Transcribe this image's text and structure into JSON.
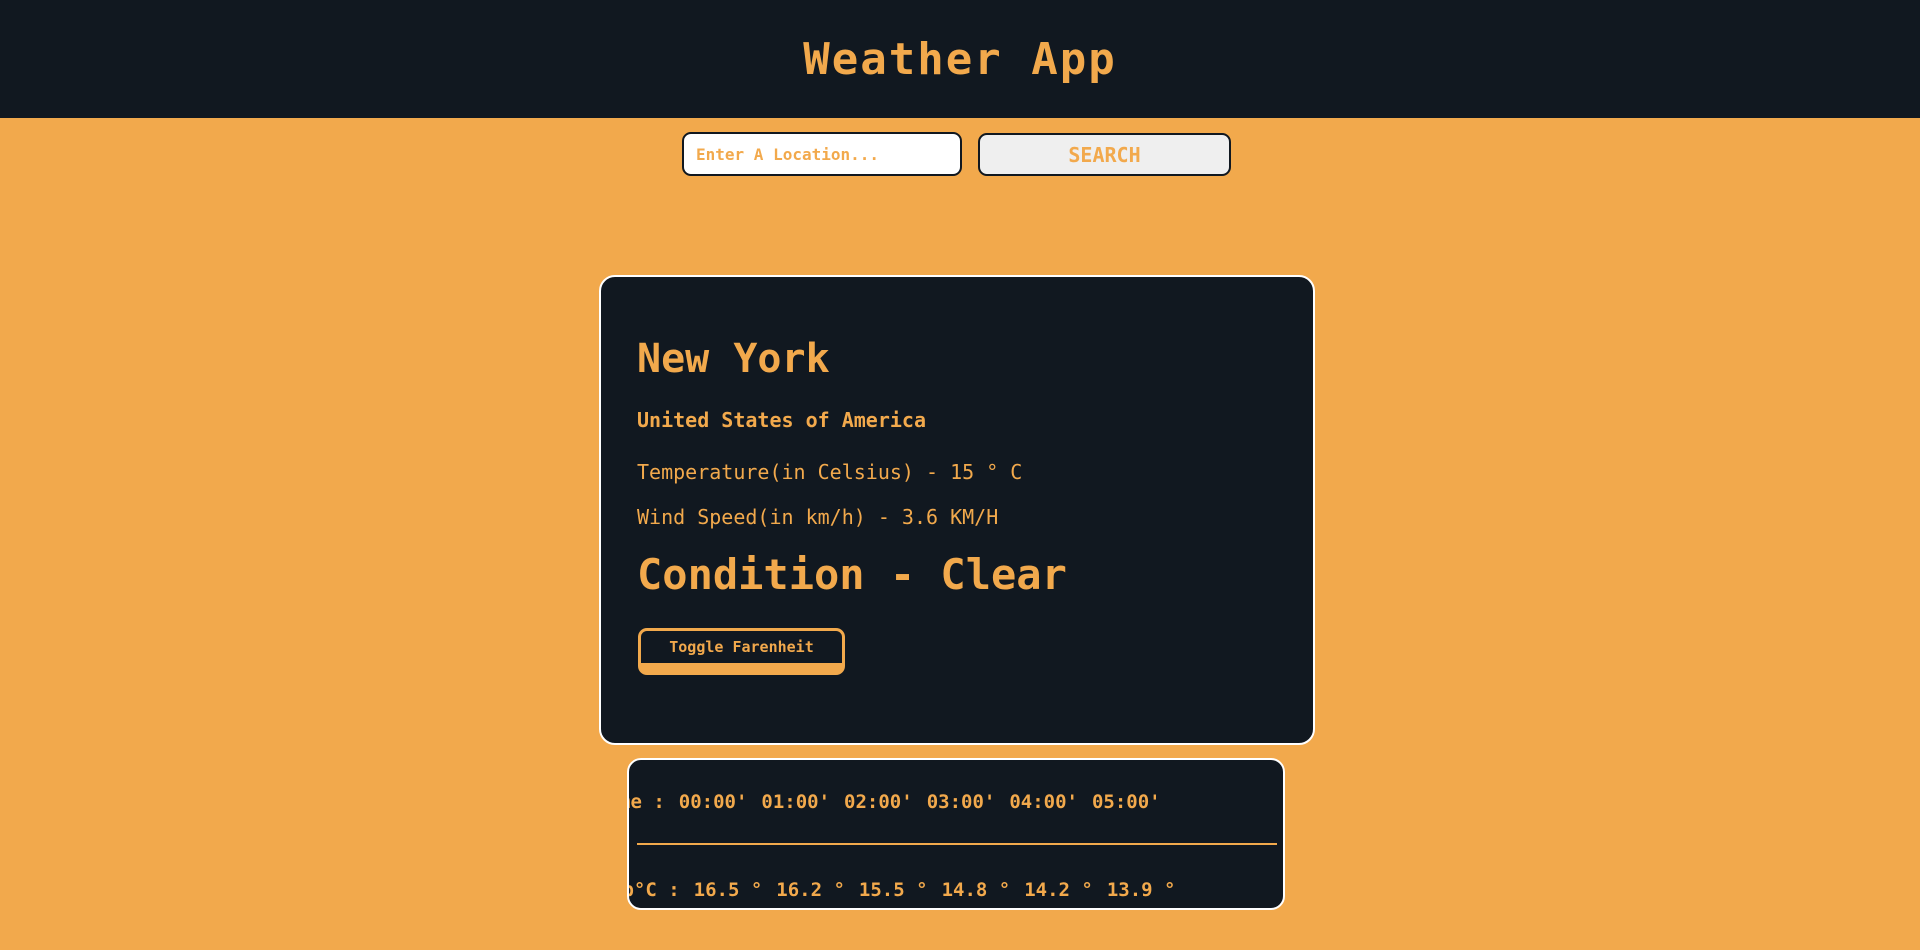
{
  "header": {
    "title": "Weather App"
  },
  "search": {
    "placeholder": "Enter A Location...",
    "value": "",
    "button_label": "SEARCH"
  },
  "card": {
    "city": "New York",
    "country": "United States of America",
    "temperature_text": "Temperature(in Celsius) - 15 ° C",
    "wind_text": "Wind Speed(in km/h) - 3.6 KM/H",
    "condition_text": "Condition - Clear",
    "toggle_label": "Toggle Farenheit"
  },
  "hourly": {
    "time_label": "me :",
    "times": [
      "00:00'",
      "01:00'",
      "02:00'",
      "03:00'",
      "04:00'",
      "05:00'"
    ],
    "temp_label": "mp°C :",
    "temps": [
      "16.5 °",
      "16.2 °",
      "15.5 °",
      "14.8 °",
      "14.2 °",
      "13.9 °"
    ]
  },
  "colors": {
    "accent": "#f2a94c",
    "dark": "#111820",
    "border": "#ffffff"
  }
}
